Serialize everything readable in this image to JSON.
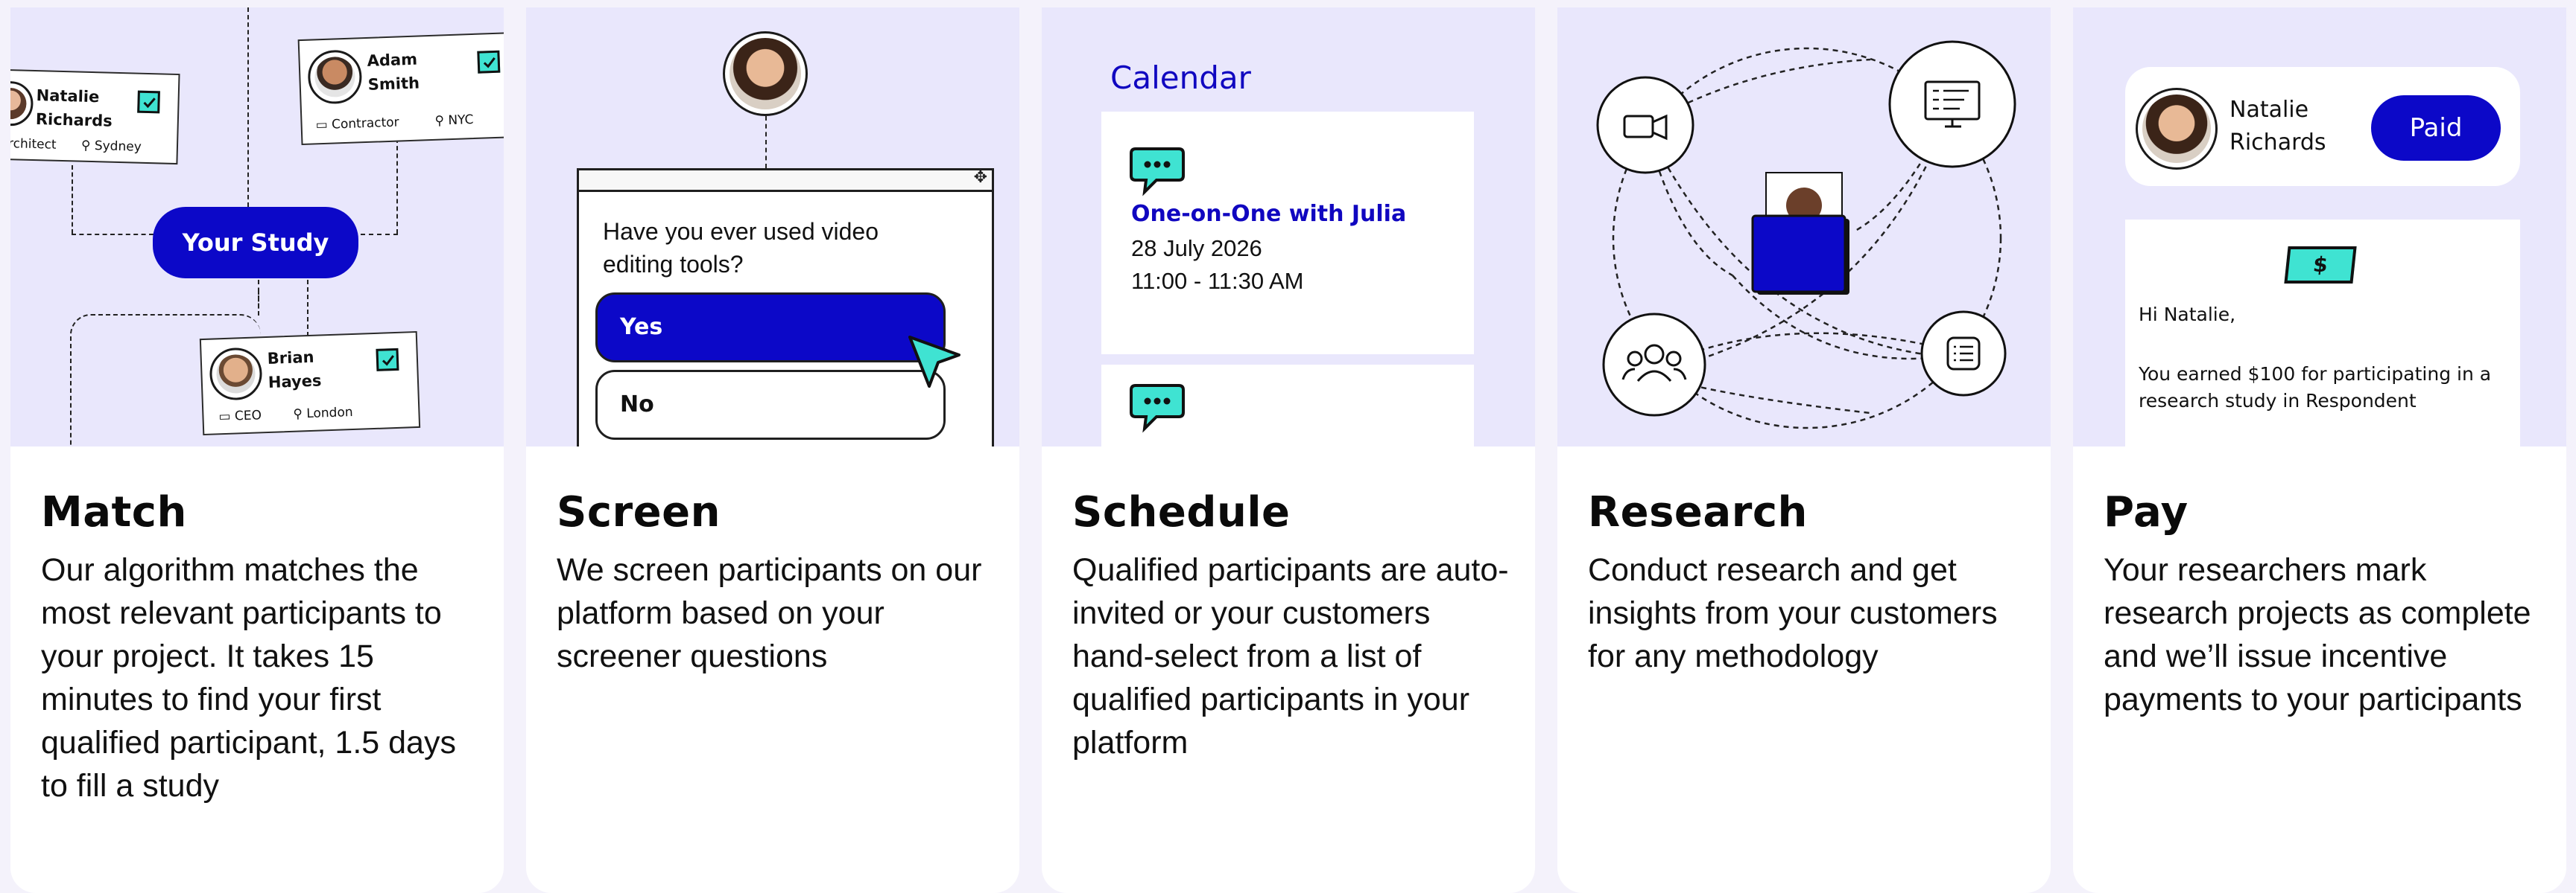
{
  "colors": {
    "accent": "#0c08c8",
    "teal": "#3fe3d2",
    "illustration_bg": "#e9e7fc"
  },
  "match": {
    "title": "Match",
    "description": "Our algorithm matches the most relevant participants to your project. It takes 15 minutes to find your first qualified participant, 1.5 days to fill a study",
    "center_pill": "Your Study",
    "profiles": [
      {
        "first": "Natalie",
        "last": "Richards",
        "role": "rchitect",
        "location": "Sydney"
      },
      {
        "first": "Adam",
        "last": "Smith",
        "role": "Contractor",
        "location": "NYC"
      },
      {
        "first": "Brian",
        "last": "Hayes",
        "role": "CEO",
        "location": "London"
      }
    ]
  },
  "screen": {
    "title": "Screen",
    "description": "We screen participants on our platform based on your screener questions",
    "question": "Have you ever used video editing tools?",
    "options": [
      "Yes",
      "No"
    ]
  },
  "schedule": {
    "title": "Schedule",
    "description": "Qualified participants are auto-invited or your customers hand-select from a list of qualified participants in your platform",
    "calendar_label": "Calendar",
    "event": {
      "title": "One-on-One with Julia",
      "date": "28 July 2026",
      "time": "11:00 - 11:30 AM"
    }
  },
  "research": {
    "title": "Research",
    "description": "Conduct research and get insights from your customers for any methodology",
    "icons": [
      "video-camera-icon",
      "screen-checklist-icon",
      "group-icon",
      "list-icon"
    ]
  },
  "pay": {
    "title": "Pay",
    "description": "Your researchers mark research projects as complete and we’ll issue incentive payments to your participants",
    "participant_first": "Natalie",
    "participant_last": "Richards",
    "status_button": "Paid",
    "money_symbol": "$",
    "greeting": "Hi Natalie,",
    "message": "You earned $100 for participating in a research study in Respondent"
  }
}
